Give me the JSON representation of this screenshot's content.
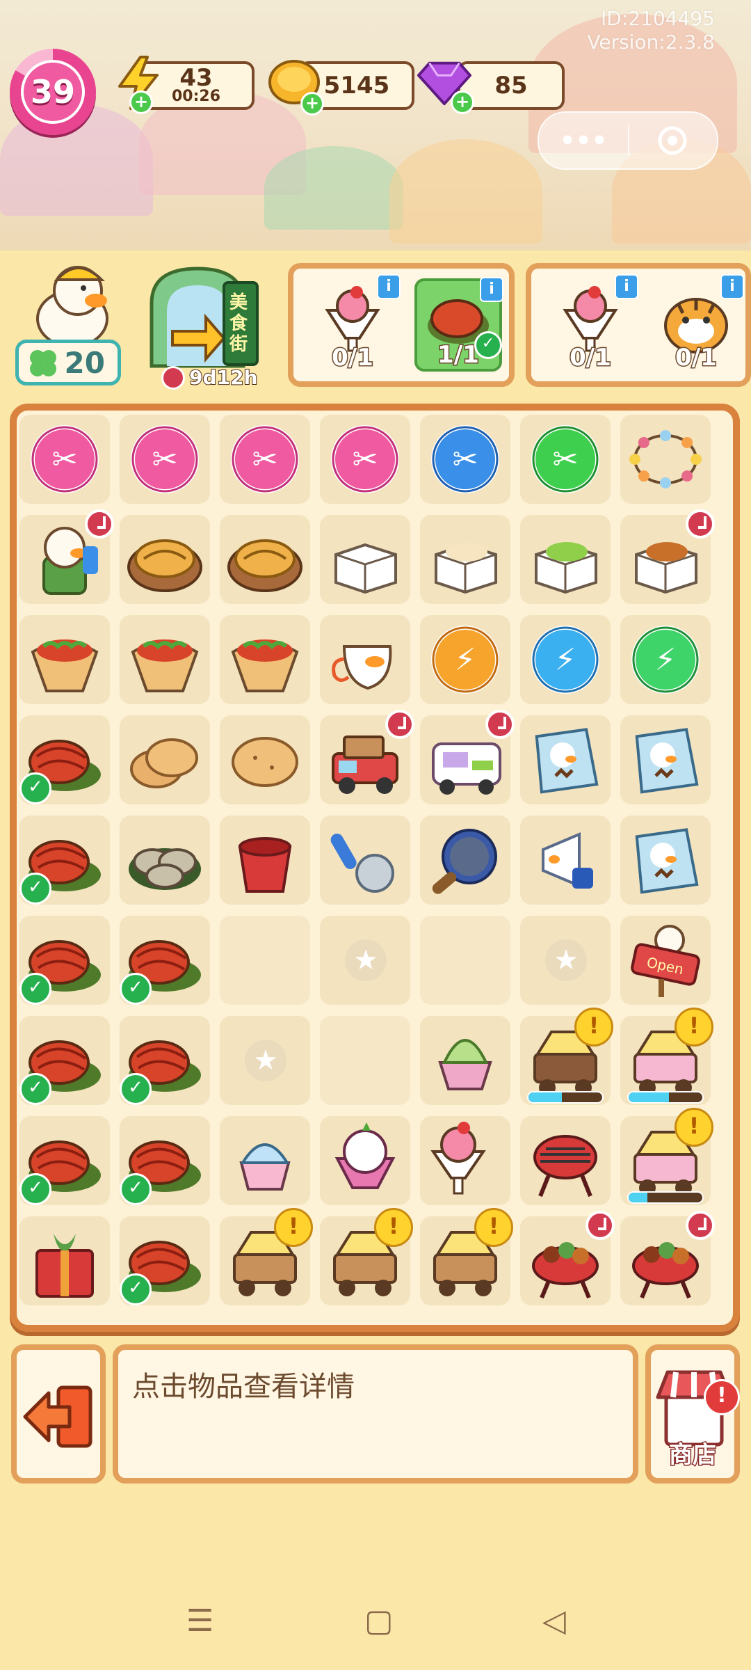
{
  "header": {
    "id_text": "ID:2104495",
    "version_text": "Version:2.3.8",
    "level": "39",
    "energy": {
      "value": "43",
      "timer": "00:26"
    },
    "coins": "5145",
    "gems": "85"
  },
  "duck_badge": {
    "value": "20"
  },
  "event": {
    "sign_text": "美食街",
    "timer": "9d12h"
  },
  "orders": [
    {
      "items": [
        {
          "icon": "sundae-icon",
          "count": "0/1",
          "done": false
        },
        {
          "icon": "crayfish-icon",
          "count": "1/1",
          "done": true
        }
      ]
    },
    {
      "items": [
        {
          "icon": "sundae-icon",
          "count": "0/1",
          "done": false
        },
        {
          "icon": "tiger-customer-icon",
          "count": "0/1",
          "done": false
        }
      ]
    }
  ],
  "board": {
    "rows": [
      [
        {
          "icon": "pink-scissors-icon"
        },
        {
          "icon": "pink-scissors-icon"
        },
        {
          "icon": "pink-scissors-icon"
        },
        {
          "icon": "pink-scissors-icon"
        },
        {
          "icon": "blue-scissors-icon"
        },
        {
          "icon": "green-scissors-icon"
        },
        {
          "icon": "string-lights-icon"
        }
      ],
      [
        {
          "icon": "duck-chef-generator-icon",
          "clock": true
        },
        {
          "icon": "pie-basket-icon"
        },
        {
          "icon": "pie-basket-icon"
        },
        {
          "icon": "takeout-box-closed-icon"
        },
        {
          "icon": "takeout-box-open-icon"
        },
        {
          "icon": "takeout-box-food-icon"
        },
        {
          "icon": "takeout-box-chicken-icon",
          "clock": true
        }
      ],
      [
        {
          "icon": "burrito-icon"
        },
        {
          "icon": "burrito-icon"
        },
        {
          "icon": "burrito-icon"
        },
        {
          "icon": "duck-mask-icon"
        },
        {
          "icon": "orange-energy-icon"
        },
        {
          "icon": "blue-energy-icon"
        },
        {
          "icon": "green-energy-icon"
        }
      ],
      [
        {
          "icon": "crayfish-icon",
          "check": true
        },
        {
          "icon": "flatbread-stack-icon"
        },
        {
          "icon": "flatbread-icon"
        },
        {
          "icon": "delivery-truck-icon",
          "clock": true
        },
        {
          "icon": "food-van-icon",
          "clock": true
        },
        {
          "icon": "seed-packet-icon"
        },
        {
          "icon": "seed-packet-icon"
        }
      ],
      [
        {
          "icon": "crayfish-icon",
          "check": true
        },
        {
          "icon": "oyster-plate-icon"
        },
        {
          "icon": "red-bucket-icon"
        },
        {
          "icon": "scoop-icon"
        },
        {
          "icon": "frying-pan-icon"
        },
        {
          "icon": "megaphone-icon"
        },
        {
          "icon": "seed-packet-icon"
        }
      ],
      [
        {
          "icon": "crayfish-icon",
          "check": true
        },
        {
          "icon": "crayfish-icon",
          "check": true
        },
        {
          "icon": "empty"
        },
        {
          "icon": "locked"
        },
        {
          "icon": "empty"
        },
        {
          "icon": "locked"
        },
        {
          "icon": "open-sign-icon"
        }
      ],
      [
        {
          "icon": "crayfish-icon",
          "check": true
        },
        {
          "icon": "crayfish-icon",
          "check": true
        },
        {
          "icon": "locked"
        },
        {
          "icon": "empty"
        },
        {
          "icon": "matcha-icecream-icon"
        },
        {
          "icon": "grill-cart-icon",
          "alert": true,
          "progress": 0.45
        },
        {
          "icon": "pink-icecream-cart-icon",
          "alert": true,
          "progress": 0.55
        }
      ],
      [
        {
          "icon": "crayfish-icon",
          "check": true
        },
        {
          "icon": "crayfish-icon",
          "check": true
        },
        {
          "icon": "shaved-ice-icon"
        },
        {
          "icon": "parfait-icon"
        },
        {
          "icon": "sundae-icon"
        },
        {
          "icon": "bbq-grill-icon"
        },
        {
          "icon": "pink-icecream-cart-icon",
          "alert": true,
          "progress": 0.25
        }
      ],
      [
        {
          "icon": "gift-box-icon"
        },
        {
          "icon": "crayfish-icon",
          "check": true
        },
        {
          "icon": "snack-cart-icon",
          "alert": true
        },
        {
          "icon": "snack-cart-icon",
          "alert": true
        },
        {
          "icon": "snack-cart-icon",
          "alert": true
        },
        {
          "icon": "bbq-skewers-icon",
          "clock": true
        },
        {
          "icon": "bbq-skewers-icon",
          "clock": true
        }
      ]
    ]
  },
  "bottom": {
    "hint": "点击物品查看详情",
    "shop_label": "商店"
  },
  "colors": {
    "accent": "#e2a05a",
    "level": "#e8448f",
    "check": "#27b04e"
  }
}
